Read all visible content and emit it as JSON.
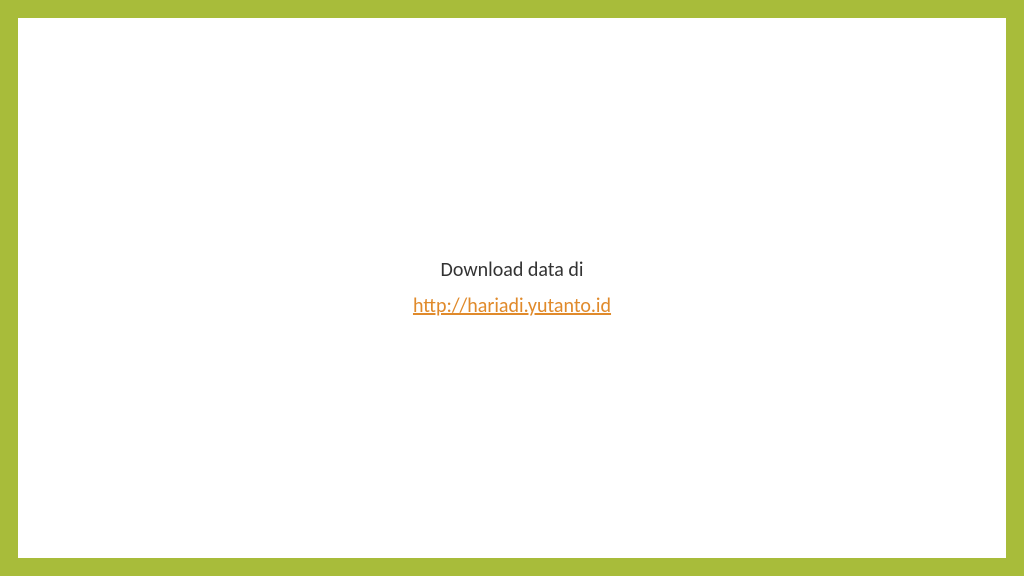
{
  "slide": {
    "title": "Download data di",
    "link_text": "http://hariadi.yutanto.id"
  }
}
